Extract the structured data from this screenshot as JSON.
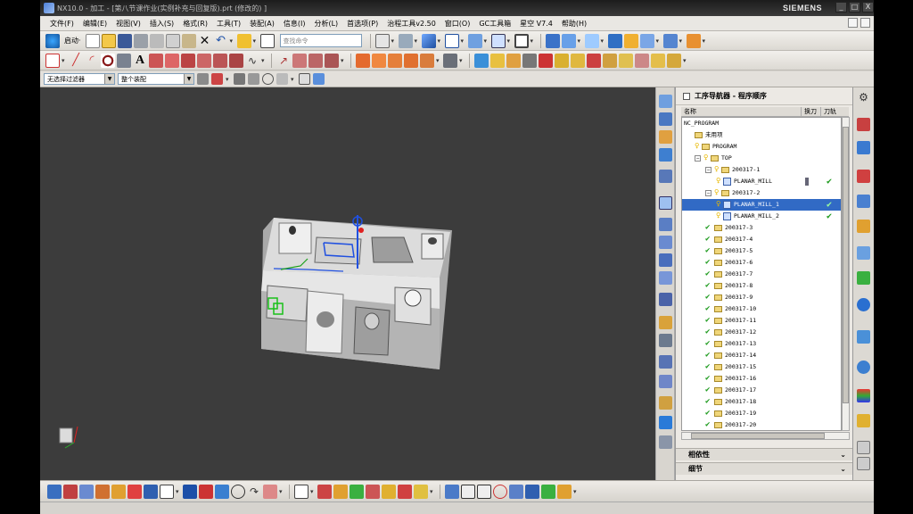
{
  "window": {
    "title": "NX10.0 - 加工 - [第八节课作业(实例补充与回复版).prt  (修改的)  ]",
    "brand": "SIEMENS",
    "controls": [
      "_",
      "□",
      "X"
    ]
  },
  "menubar": {
    "items": [
      "文件(F)",
      "编辑(E)",
      "视图(V)",
      "插入(S)",
      "格式(R)",
      "工具(T)",
      "装配(A)",
      "信息(I)",
      "分析(L)",
      "首选项(P)",
      "治程工具v2.50",
      "窗口(O)",
      "GC工具箱",
      "星空 V7.4",
      "帮助(H)"
    ]
  },
  "toolbar1": {
    "start_label": "启动·",
    "search_placeholder": "查找命令"
  },
  "selection_bar": {
    "filter_value": "无选择过滤器",
    "scope_value": "整个装配"
  },
  "navigator": {
    "title": "工序导航器 - 程序顺序",
    "col_name": "名称",
    "col_toolchange": "换刀",
    "col_toolpath": "刀轨",
    "rows": [
      {
        "label": "NC_PROGRAM",
        "indent": 0,
        "kind": "root"
      },
      {
        "label": "未用项",
        "indent": 1,
        "kind": "folder"
      },
      {
        "label": "PROGRAM",
        "indent": 1,
        "kind": "folder-bulb"
      },
      {
        "label": "TOP",
        "indent": 1,
        "kind": "folder-bulb-pm"
      },
      {
        "label": "200317-1",
        "indent": 2,
        "kind": "folder-bulb-pm"
      },
      {
        "label": "PLANAR_MILL",
        "indent": 3,
        "kind": "op",
        "tool": true,
        "ok": true
      },
      {
        "label": "200317-2",
        "indent": 2,
        "kind": "folder-bulb-pm"
      },
      {
        "label": "PLANAR_MILL_1",
        "indent": 3,
        "kind": "op",
        "selected": true,
        "ok": true
      },
      {
        "label": "PLANAR_MILL_2",
        "indent": 3,
        "kind": "op",
        "ok": true
      },
      {
        "label": "200317-3",
        "indent": 2,
        "kind": "folder-check"
      },
      {
        "label": "200317-4",
        "indent": 2,
        "kind": "folder-check"
      },
      {
        "label": "200317-5",
        "indent": 2,
        "kind": "folder-check"
      },
      {
        "label": "200317-6",
        "indent": 2,
        "kind": "folder-check"
      },
      {
        "label": "200317-7",
        "indent": 2,
        "kind": "folder-check"
      },
      {
        "label": "200317-8",
        "indent": 2,
        "kind": "folder-check"
      },
      {
        "label": "200317-9",
        "indent": 2,
        "kind": "folder-check"
      },
      {
        "label": "200317-10",
        "indent": 2,
        "kind": "folder-check"
      },
      {
        "label": "200317-11",
        "indent": 2,
        "kind": "folder-check"
      },
      {
        "label": "200317-12",
        "indent": 2,
        "kind": "folder-check"
      },
      {
        "label": "200317-13",
        "indent": 2,
        "kind": "folder-check"
      },
      {
        "label": "200317-14",
        "indent": 2,
        "kind": "folder-check"
      },
      {
        "label": "200317-15",
        "indent": 2,
        "kind": "folder-check"
      },
      {
        "label": "200317-16",
        "indent": 2,
        "kind": "folder-check"
      },
      {
        "label": "200317-17",
        "indent": 2,
        "kind": "folder-check"
      },
      {
        "label": "200317-18",
        "indent": 2,
        "kind": "folder-check"
      },
      {
        "label": "200317-19",
        "indent": 2,
        "kind": "folder-check"
      },
      {
        "label": "200317-20",
        "indent": 2,
        "kind": "folder-check"
      }
    ],
    "section_dependencies": "相依性",
    "section_details": "细节"
  },
  "colors": {
    "viewport_bg": "#3c3c3c",
    "selection": "#316ac5",
    "check_green": "#1c9a1c",
    "title_bg": "#1c1c1c"
  }
}
